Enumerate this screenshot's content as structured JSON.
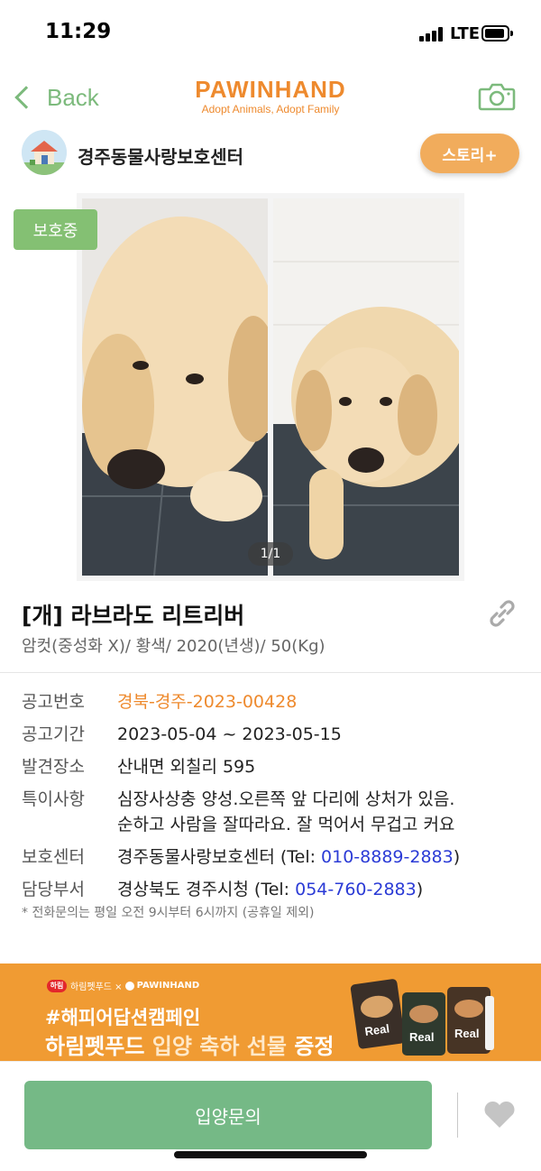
{
  "status_bar": {
    "time": "11:29",
    "network": "LTE"
  },
  "nav": {
    "back_label": "Back",
    "logo_title": "PAWINHAND",
    "logo_subtitle": "Adopt Animals, Adopt Family",
    "camera_icon": "camera-icon"
  },
  "shelter": {
    "name": "경주동물사랑보호센터",
    "story_button": "스토리+"
  },
  "photo": {
    "status_badge": "보호중",
    "counter": "1/1"
  },
  "animal": {
    "title": "[개] 라브라도 리트리버",
    "subtitle": "암컷(중성화 X)/ 황색/ 2020(년생)/ 50(Kg)"
  },
  "info": {
    "notice_no_label": "공고번호",
    "notice_no": "경북-경주-2023-00428",
    "period_label": "공고기간",
    "period": "2023-05-04 ~ 2023-05-15",
    "found_label": "발견장소",
    "found": "산내면 외칠리 595",
    "special_label": "특이사항",
    "special_line1": "심장사상충 양성.오른쪽 앞 다리에 상처가 있음.",
    "special_line2": "순하고 사람을 잘따라요. 잘 먹어서 무겁고 커요",
    "center_label": "보호센터",
    "center_name": "경주동물사랑보호센터 (Tel: ",
    "center_phone": "010-8889-2883",
    "center_close": ")",
    "dept_label": "담당부서",
    "dept_name": "경상북도 경주시청 (Tel: ",
    "dept_phone": "054-760-2883",
    "dept_close": ")",
    "note": "* 전화문의는 평일 오전 9시부터 6시까지 (공휴일 제외)"
  },
  "banner": {
    "brand_logo": "하림",
    "brand_text": "하림펫푸드 × ",
    "partner": "PAWINHAND",
    "line1": "#해피어답션캠페인",
    "line2_a": "하림펫푸드 ",
    "line2_b": "입양 축하 선물",
    "line2_c": " 증정",
    "product_label": "Real"
  },
  "bottom": {
    "adopt_button": "입양문의",
    "heart_icon": "heart-icon"
  },
  "colors": {
    "brand_orange": "#ee8a2e",
    "accent_green": "#75b986",
    "badge_green": "#84c073",
    "phone_blue": "#2b3bd6",
    "banner_orange": "#f09b33"
  }
}
